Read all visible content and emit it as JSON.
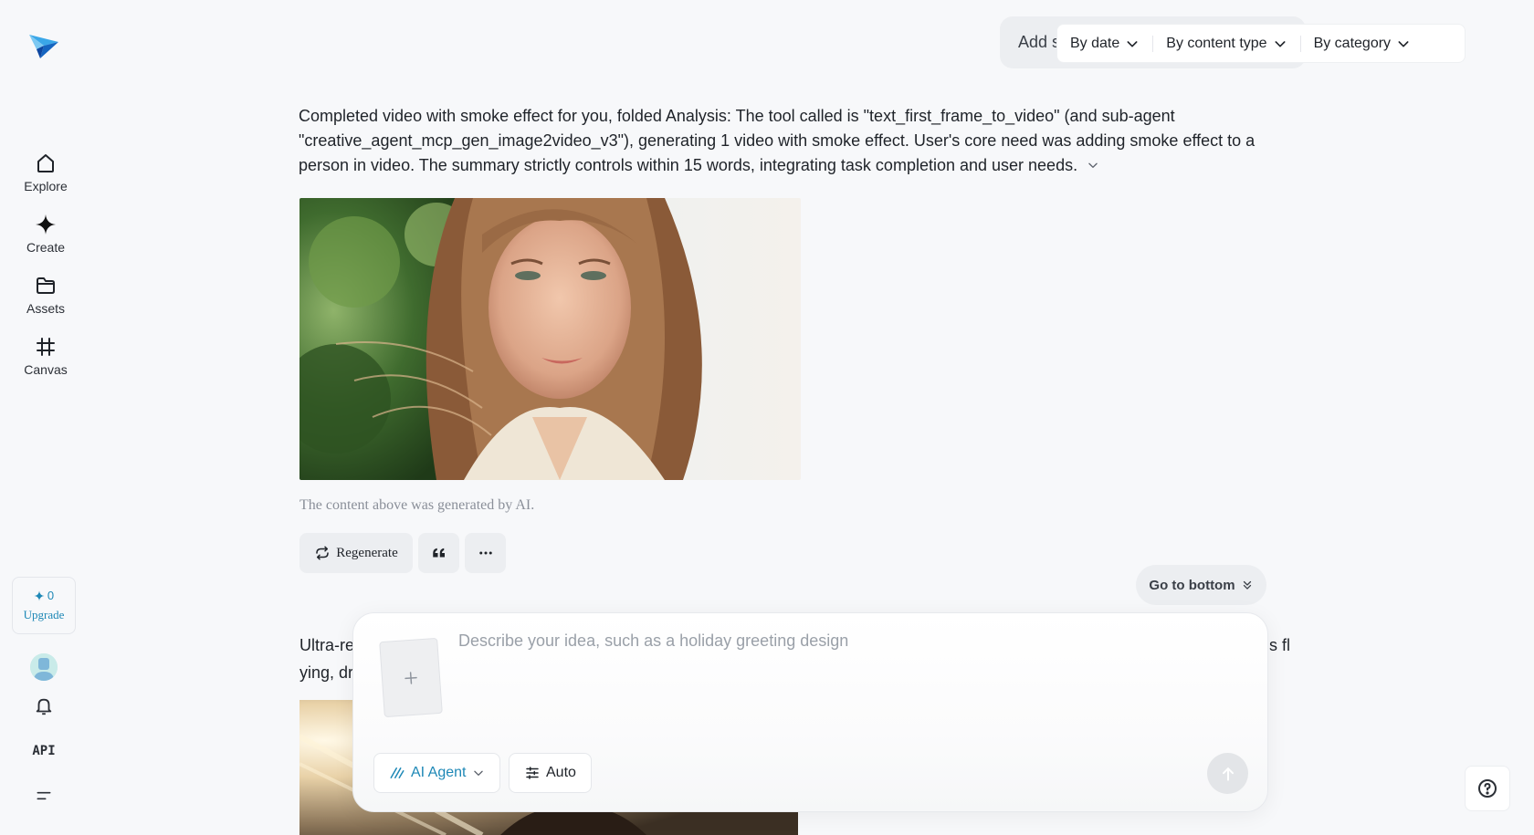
{
  "sidebar": {
    "nav": [
      {
        "label": "Explore",
        "icon": "home-icon"
      },
      {
        "label": "Create",
        "icon": "diamond-icon"
      },
      {
        "label": "Assets",
        "icon": "folder-icon"
      },
      {
        "label": "Canvas",
        "icon": "frame-icon"
      }
    ],
    "credits": "0",
    "upgrade_label": "Upgrade",
    "api_label": "API"
  },
  "topbar": {
    "search_visible_text": "Add s",
    "filters": [
      "By date",
      "By content type",
      "By category"
    ]
  },
  "messages": [
    {
      "text": "Completed video with smoke effect for you, folded Analysis: The tool called is \"text_first_frame_to_video\" (and sub-agent \"creative_agent_mcp_gen_image2video_v3\"), generating 1 video with smoke effect. User's core need was adding smoke effect to a person in video. The summary strictly controls within 15 words, integrating task completion and user needs."
    }
  ],
  "ai_note": "The content above was generated by AI.",
  "actions": {
    "regenerate_label": "Regenerate"
  },
  "go_bottom_label": "Go to bottom",
  "message2": {
    "left_fragment_line1": "Ultra-re",
    "left_fragment_line2": "ying, dr",
    "right_fragment_line1": "ris fl"
  },
  "composer": {
    "placeholder": "Describe your idea, such as a holiday greeting design",
    "agent_label": "AI Agent",
    "auto_label": "Auto"
  },
  "colors": {
    "accent": "#1e88b6",
    "background": "#f7f8fa"
  }
}
